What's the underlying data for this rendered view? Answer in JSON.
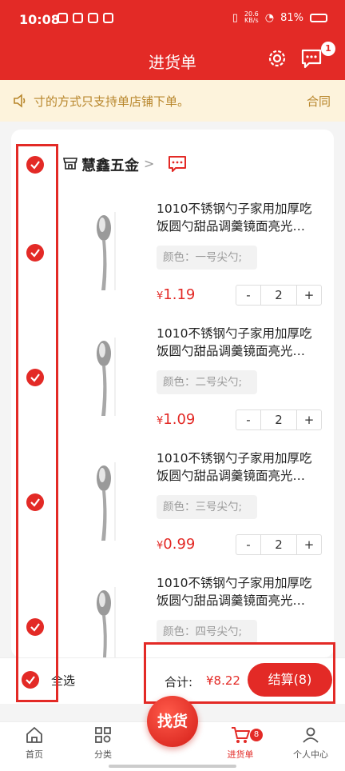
{
  "status_bar": {
    "time": "10:08",
    "net_speed_top": "20.6",
    "net_speed_bottom": "KB/s",
    "battery": "81%"
  },
  "header": {
    "title": "进货单",
    "message_badge": "1"
  },
  "notice": {
    "text": "寸的方式只支持单店铺下单。",
    "link": "合同"
  },
  "store": {
    "name": "慧鑫五金",
    "arrow": ">"
  },
  "products": [
    {
      "title": "1010不锈钢勺子家用加厚吃饭圆勺甜品调羹镜面亮光…",
      "spec": "颜色：一号尖勺;",
      "price_symbol": "¥",
      "price": "1.19",
      "qty": "2"
    },
    {
      "title": "1010不锈钢勺子家用加厚吃饭圆勺甜品调羹镜面亮光…",
      "spec": "颜色：二号尖勺;",
      "price_symbol": "¥",
      "price": "1.09",
      "qty": "2"
    },
    {
      "title": "1010不锈钢勺子家用加厚吃饭圆勺甜品调羹镜面亮光…",
      "spec": "颜色：三号尖勺;",
      "price_symbol": "¥",
      "price": "0.99",
      "qty": "2"
    },
    {
      "title": "1010不锈钢勺子家用加厚吃饭圆勺甜品调羹镜面亮光…",
      "spec": "颜色：四号尖勺;"
    }
  ],
  "stepper": {
    "minus": "-",
    "plus": "+"
  },
  "bottom": {
    "select_all": "全选",
    "total_label": "合计:",
    "total_value": "¥8.22",
    "checkout": "结算(8)"
  },
  "tabs": {
    "home": "首页",
    "category": "分类",
    "find": "找货",
    "cart": "进货单",
    "cart_badge": "8",
    "profile": "个人中心"
  },
  "colors": {
    "primary": "#e32a26",
    "notice_bg": "#fdf3dc",
    "notice_text": "#b8862b"
  }
}
